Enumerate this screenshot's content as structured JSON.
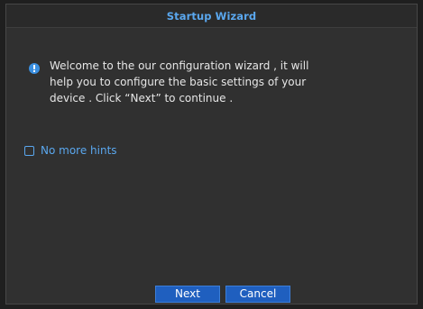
{
  "dialog": {
    "title": "Startup Wizard",
    "message": "Welcome to the our configuration wizard , it will help you to configure the basic settings of your device . Click “Next” to continue .",
    "info_icon": "info-icon",
    "hint": {
      "label": "No more hints",
      "checked": false
    },
    "buttons": {
      "next_label": "Next",
      "cancel_label": "Cancel"
    }
  },
  "colors": {
    "accent": "#5aa7ee",
    "button": "#1f5fbf",
    "background": "#303030"
  }
}
